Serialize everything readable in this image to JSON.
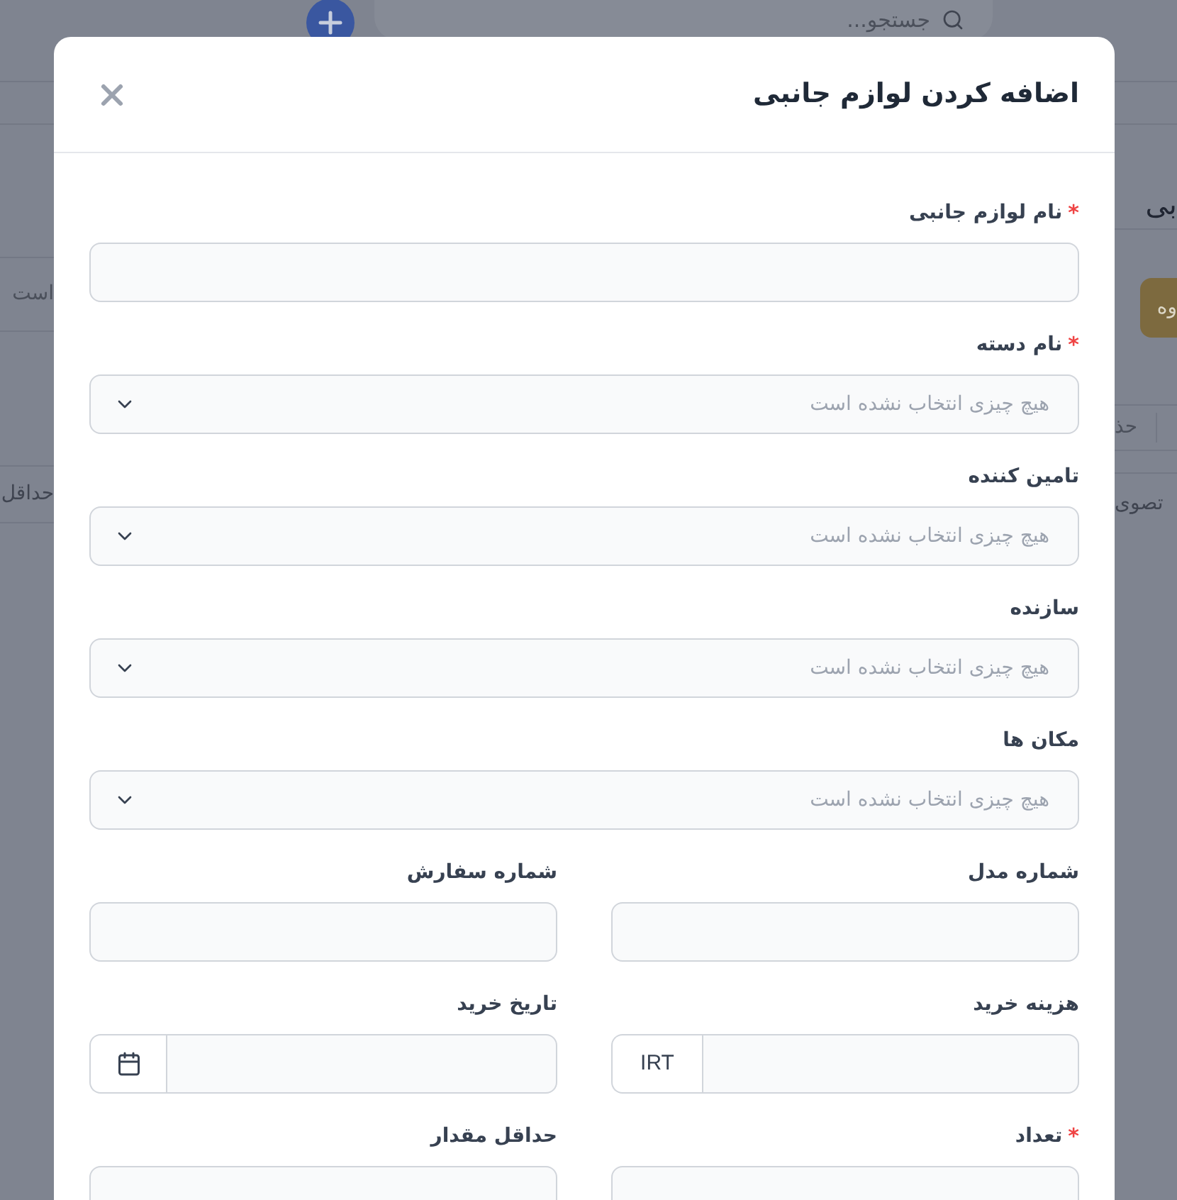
{
  "background": {
    "search_placeholder": "جستجو...",
    "page_title": "بی",
    "action_button": "وه",
    "filter_field": "است",
    "column_1": "حذ",
    "cell_1": "تصوی",
    "cell_2": "حداقل"
  },
  "modal": {
    "title": "اضافه کردن لوازم جانبی"
  },
  "required_mark": "*",
  "rows": [
    [
      {
        "kind": "text",
        "label": "نام لوازم جانبی",
        "required": true
      }
    ],
    [
      {
        "kind": "select",
        "label": "نام دسته",
        "required": true,
        "placeholder": "هیچ چیزی انتخاب نشده است"
      }
    ],
    [
      {
        "kind": "select",
        "label": "تامین کننده",
        "required": false,
        "placeholder": "هیچ چیزی انتخاب نشده است"
      }
    ],
    [
      {
        "kind": "select",
        "label": "سازنده",
        "required": false,
        "placeholder": "هیچ چیزی انتخاب نشده است"
      }
    ],
    [
      {
        "kind": "select",
        "label": "مکان ها",
        "required": false,
        "placeholder": "هیچ چیزی انتخاب نشده است"
      }
    ],
    [
      {
        "kind": "text",
        "label": "شماره مدل",
        "required": false
      },
      {
        "kind": "text",
        "label": "شماره سفارش",
        "required": false
      }
    ],
    [
      {
        "kind": "currency",
        "label": "هزینه خرید",
        "required": false,
        "addon": "IRT"
      },
      {
        "kind": "date",
        "label": "تاریخ خرید",
        "required": false
      }
    ],
    [
      {
        "kind": "text",
        "label": "تعداد",
        "required": true
      },
      {
        "kind": "text",
        "label": "حداقل مقدار",
        "required": false
      }
    ]
  ]
}
